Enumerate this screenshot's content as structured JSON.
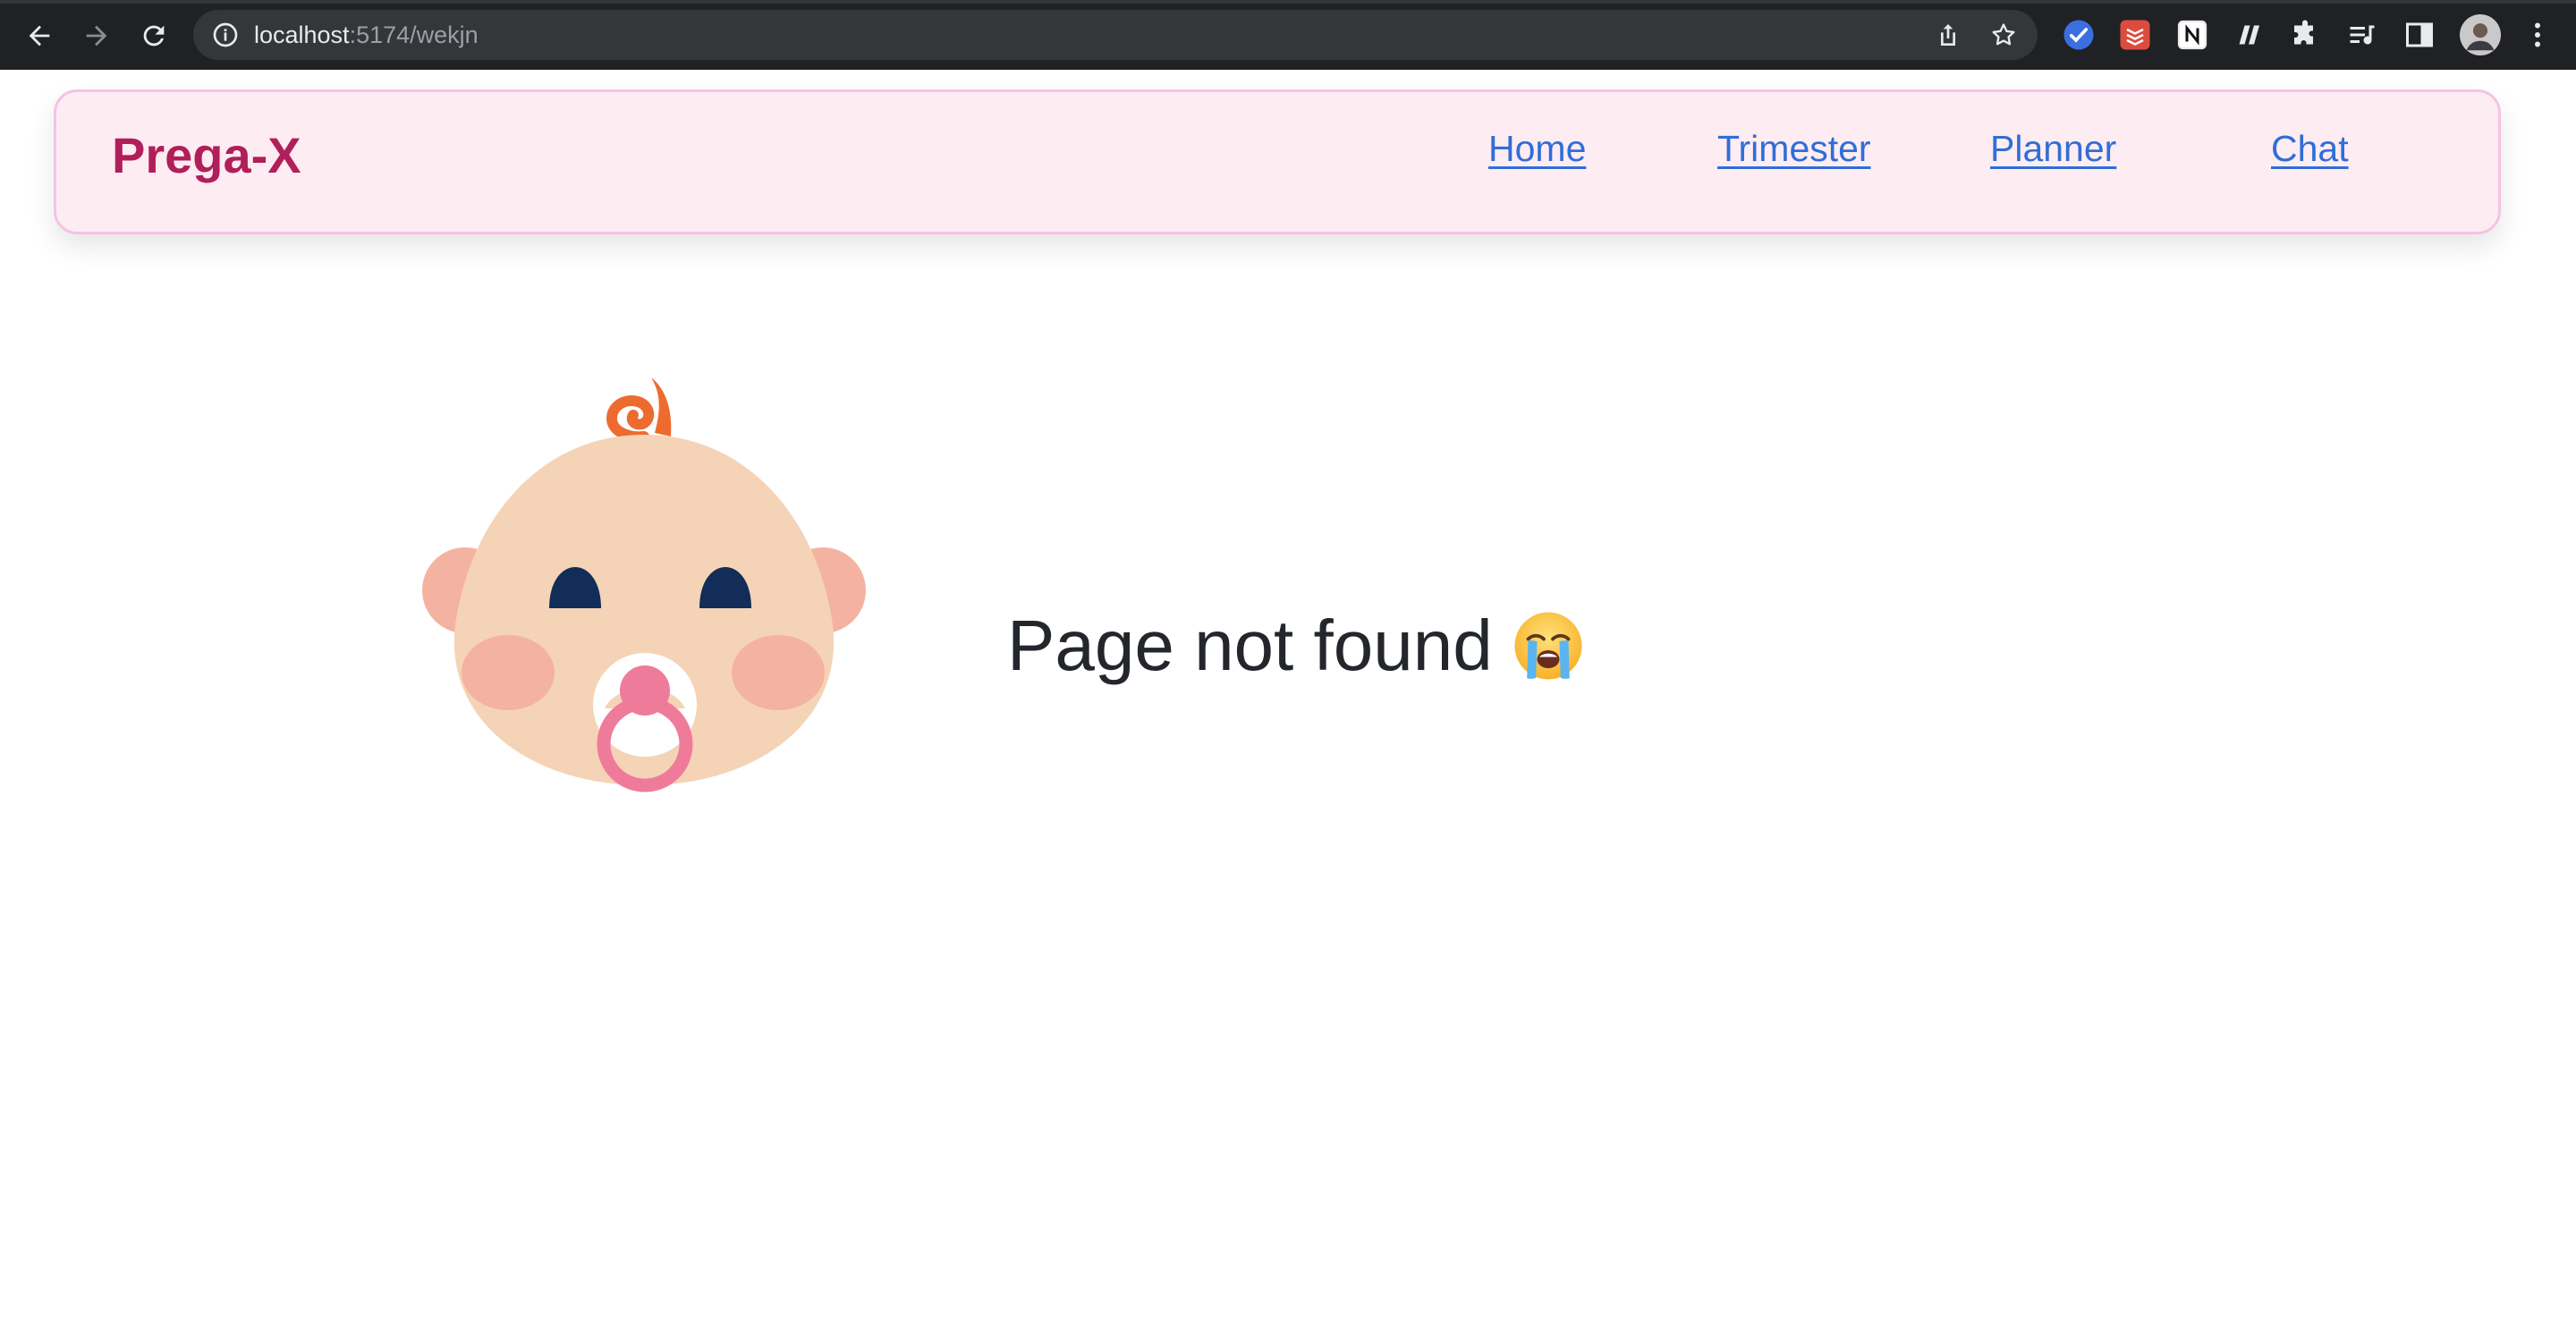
{
  "browser": {
    "url_host": "localhost",
    "url_path": ":5174/wekjn",
    "icons": {
      "back": "arrow-left-icon",
      "forward": "arrow-right-icon",
      "reload": "reload-icon",
      "site_info": "info-icon",
      "share": "share-icon",
      "bookmark": "star-icon",
      "extensions": [
        "todo-check-extension-icon",
        "todoist-extension-icon",
        "notion-extension-icon",
        "readwise-extension-icon",
        "puzzle-extensions-icon",
        "media-queue-icon",
        "side-panel-icon",
        "profile-avatar",
        "kebab-menu-icon"
      ]
    }
  },
  "navbar": {
    "brand": "Prega-X",
    "links": [
      "Home",
      "Trimester",
      "Planner",
      "Chat"
    ],
    "colors": {
      "background": "#fdecf2",
      "border": "#f4c3e5",
      "brand": "#b01f5a",
      "link": "#2f6ed6"
    }
  },
  "main": {
    "message": "Page not found",
    "emoji": "loudly-crying-face-emoji",
    "illustration": "baby-with-pacifier-illustration"
  }
}
